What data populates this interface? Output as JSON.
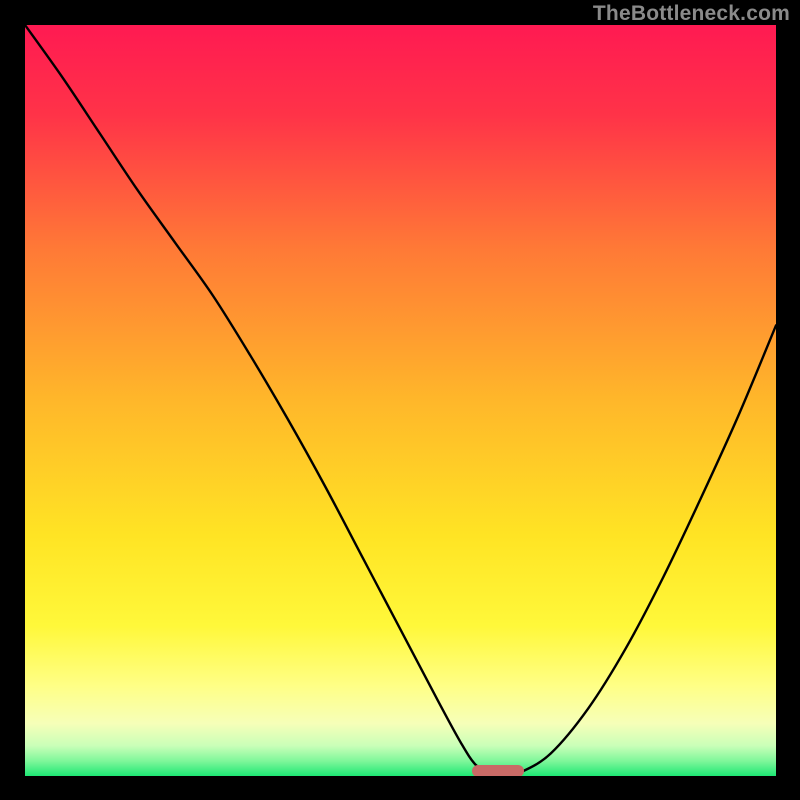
{
  "watermark": "TheBottleneck.com",
  "colors": {
    "curve": "#000000",
    "marker": "#c96a66",
    "gradient_top": "#ff1a52",
    "gradient_bottom": "#1de874"
  },
  "chart_data": {
    "type": "line",
    "title": "",
    "xlabel": "",
    "ylabel": "",
    "xlim": [
      0,
      100
    ],
    "ylim": [
      0,
      100
    ],
    "series": [
      {
        "name": "bottleneck-curve",
        "x": [
          0,
          5,
          10,
          15,
          20,
          25,
          30,
          35,
          40,
          45,
          50,
          55,
          58,
          60,
          62,
          64,
          66,
          70,
          75,
          80,
          85,
          90,
          95,
          100
        ],
        "y": [
          100,
          93,
          85.5,
          78,
          71,
          64,
          56,
          47.5,
          38.5,
          29,
          19.5,
          10,
          4.5,
          1.5,
          0.3,
          0.2,
          0.5,
          3,
          9,
          17,
          26.5,
          37,
          48,
          60
        ]
      }
    ],
    "marker": {
      "name": "optimal-range",
      "x_start": 59.5,
      "x_end": 66.5,
      "y": 0.6
    }
  }
}
